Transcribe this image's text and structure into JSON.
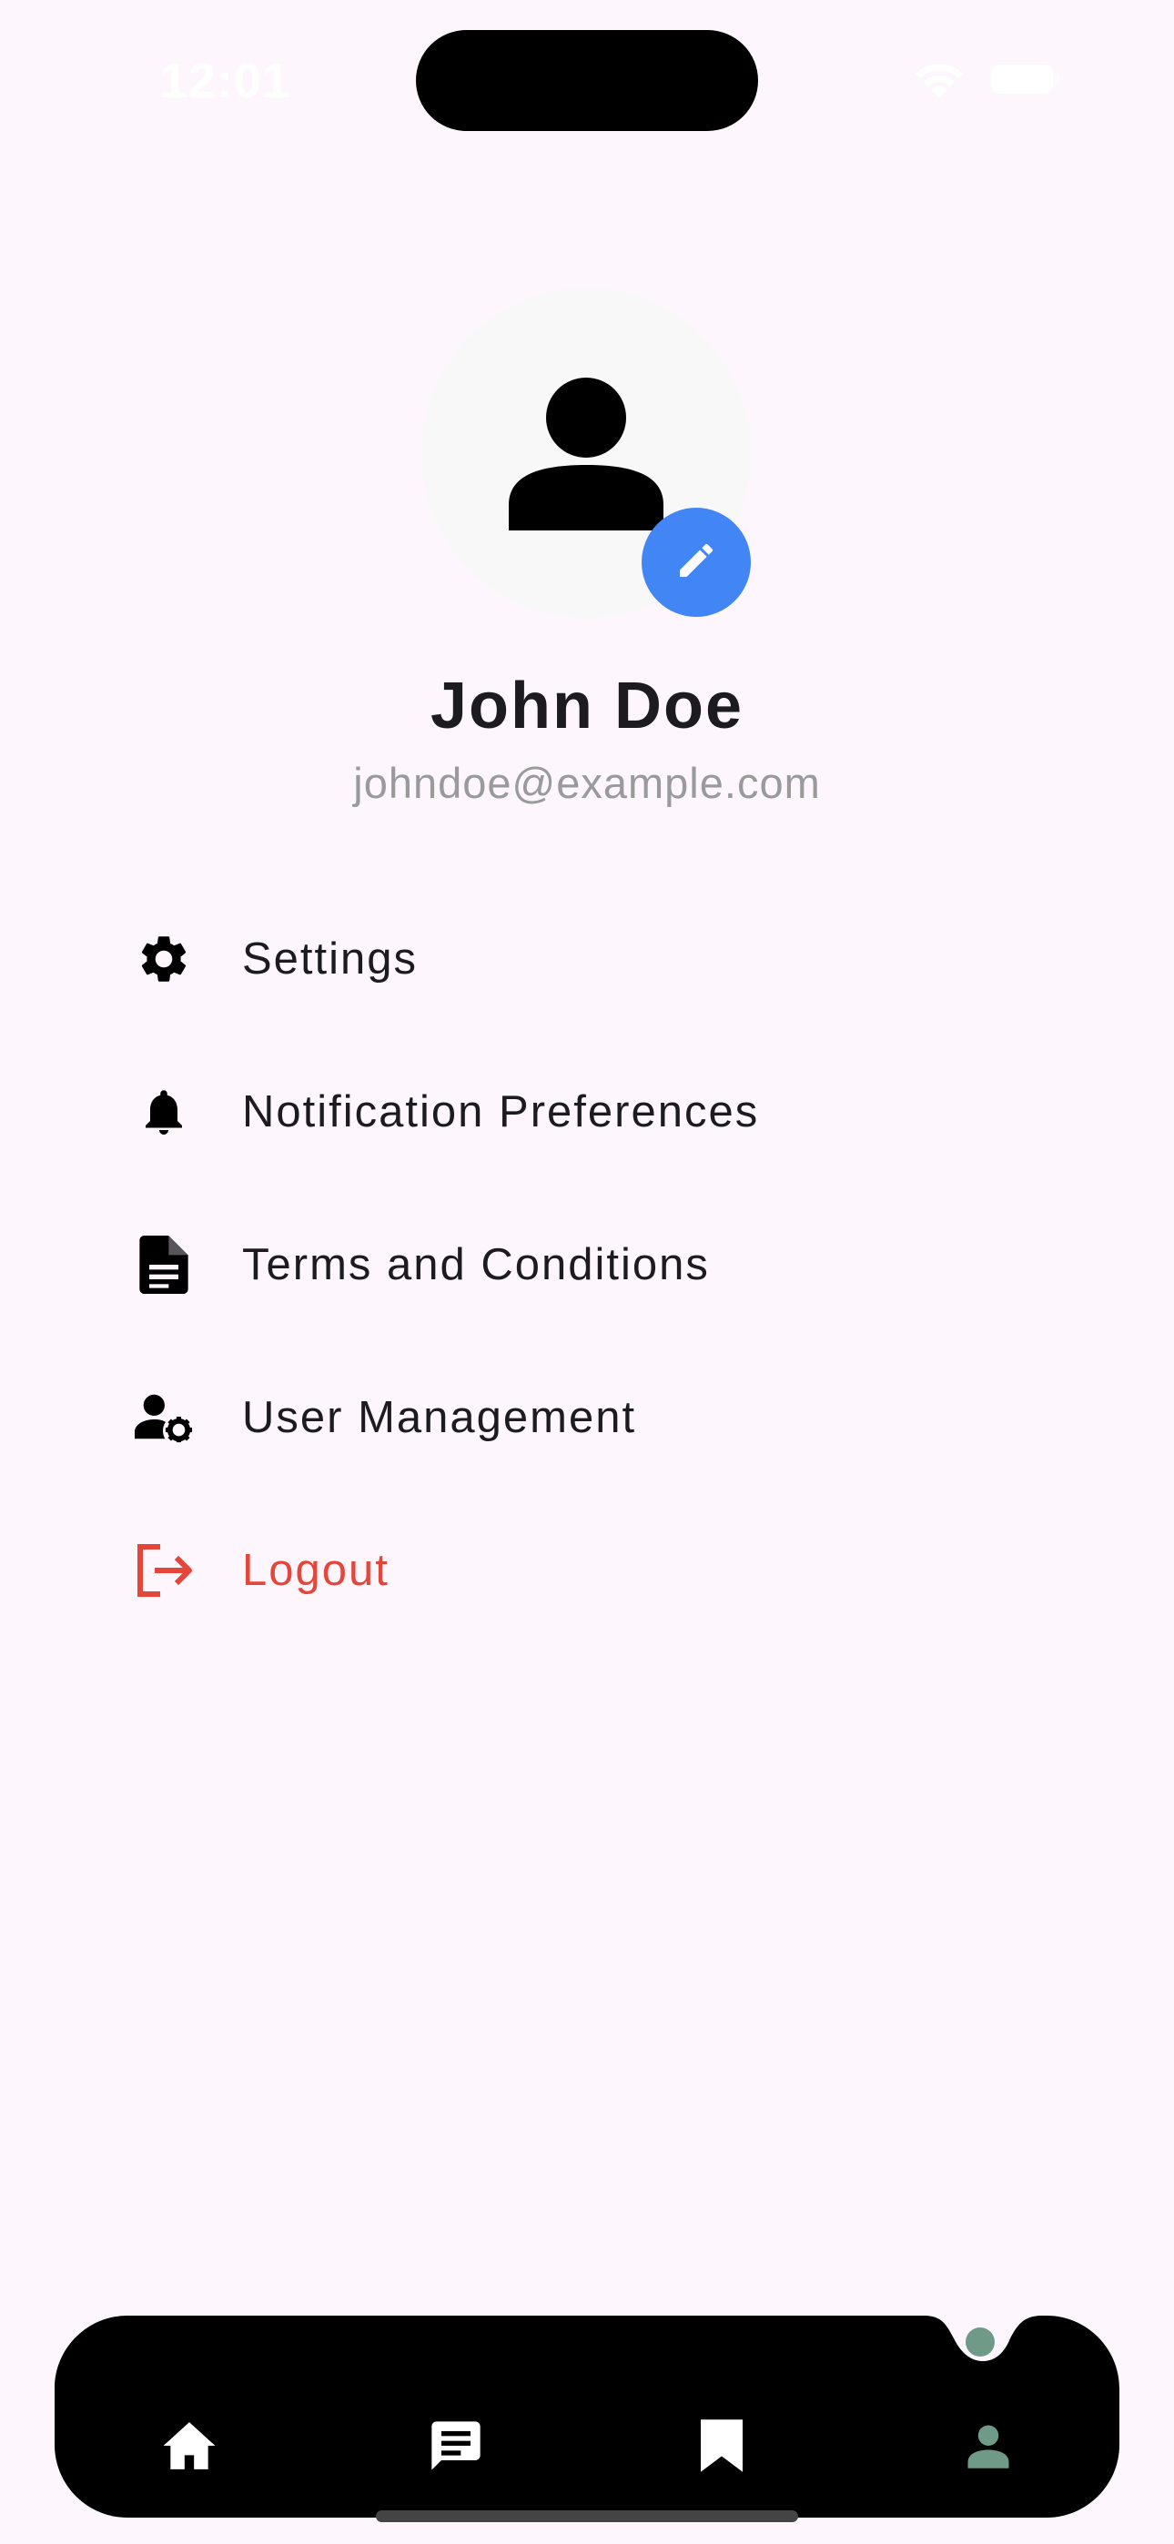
{
  "status_bar": {
    "time": "12:01"
  },
  "profile": {
    "name": "John Doe",
    "email": "johndoe@example.com"
  },
  "menu": {
    "items": [
      {
        "label": "Settings",
        "icon": "gear-icon"
      },
      {
        "label": "Notification Preferences",
        "icon": "bell-icon"
      },
      {
        "label": "Terms and Conditions",
        "icon": "document-icon"
      },
      {
        "label": "User Management",
        "icon": "user-gear-icon"
      },
      {
        "label": "Logout",
        "icon": "logout-icon"
      }
    ]
  },
  "bottom_nav": {
    "items": [
      {
        "icon": "home-icon"
      },
      {
        "icon": "chat-icon"
      },
      {
        "icon": "bookmark-icon"
      },
      {
        "icon": "person-icon",
        "active": true
      }
    ]
  },
  "colors": {
    "background": "#fdf6fd",
    "accent_blue": "#4285f4",
    "logout_red": "#e4463a",
    "nav_active": "#6f9a88",
    "nav_bar": "#000000"
  }
}
